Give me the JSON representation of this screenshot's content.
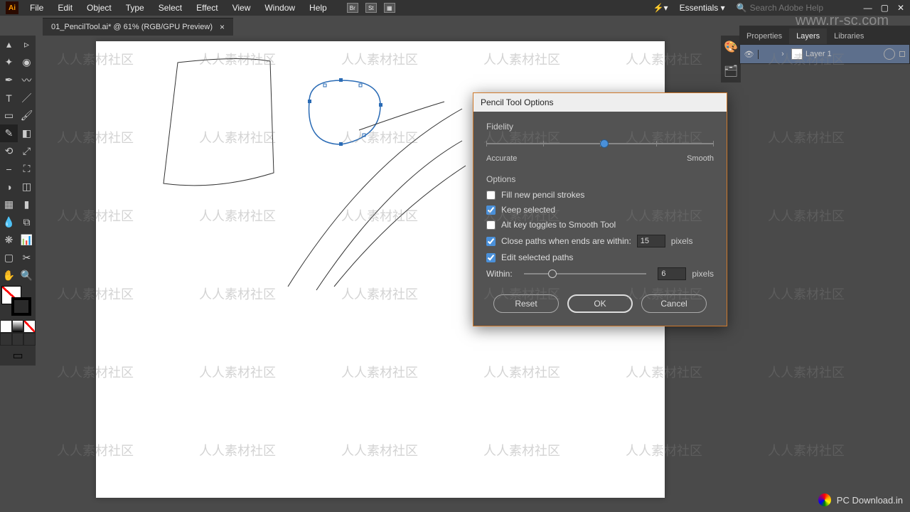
{
  "app_logo": "Ai",
  "menu": [
    "File",
    "Edit",
    "Object",
    "Type",
    "Select",
    "Effect",
    "View",
    "Window",
    "Help"
  ],
  "header_icons": {
    "br": "Br",
    "st": "St"
  },
  "workspace_dropdown": "Essentials",
  "search": {
    "placeholder": "Search Adobe Help"
  },
  "tab": {
    "title": "01_PencilTool.ai* @ 61% (RGB/GPU Preview)",
    "close": "×"
  },
  "panels": {
    "tabs": [
      "Properties",
      "Layers",
      "Libraries"
    ],
    "active_tab": "Layers",
    "layer": {
      "name": "Layer 1"
    }
  },
  "dialog": {
    "title": "Pencil Tool Options",
    "fidelity": {
      "label": "Fidelity",
      "left": "Accurate",
      "right": "Smooth",
      "value_percent": 50
    },
    "options_label": "Options",
    "options": {
      "fill_new": {
        "label": "Fill new pencil strokes",
        "checked": false
      },
      "keep_selected": {
        "label": "Keep selected",
        "checked": true
      },
      "alt_toggle": {
        "label": "Alt key toggles to Smooth Tool",
        "checked": false
      },
      "close_paths": {
        "label": "Close paths when ends are within:",
        "checked": true,
        "value": "15",
        "unit": "pixels"
      },
      "edit_selected": {
        "label": "Edit selected paths",
        "checked": true
      }
    },
    "within": {
      "label": "Within:",
      "value": "6",
      "unit": "pixels",
      "percent": 20
    },
    "buttons": {
      "reset": "Reset",
      "ok": "OK",
      "cancel": "Cancel"
    }
  },
  "watermarks": {
    "top_right": "www.rr-sc.com",
    "repeat": "人人素材社区"
  },
  "bottom_brand": "PC Download.in"
}
